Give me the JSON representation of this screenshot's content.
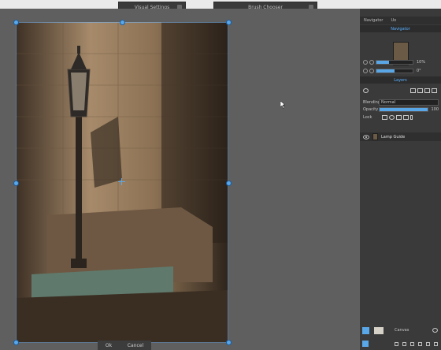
{
  "floating_tabs": {
    "visual_settings": "Visual Settings",
    "brush_chooser": "Brush Chooser"
  },
  "panel_tabs": [
    "Navigator",
    "Uo"
  ],
  "navigator": {
    "header": "Navigator",
    "zoom_value": "10%",
    "rotation_value": "0°",
    "zoom_fill": 0.35,
    "rotation_fill": 0.5
  },
  "layers": {
    "header": "Layers",
    "blending_label": "Blending",
    "blending_value": "Normal",
    "opacity_label": "Opacity",
    "opacity_value": "100",
    "opacity_fill": 1.0,
    "lock_label": "Lock",
    "layer_name": "Lamp Guide"
  },
  "bottom_bar": {
    "ok": "Ok",
    "cancel": "Cancel"
  },
  "canvas_label": "Canvas",
  "colors": {
    "accent": "#5aa7e8",
    "panel_bg": "#3a3a3a",
    "canvas_bg": "#5f5f5f"
  }
}
